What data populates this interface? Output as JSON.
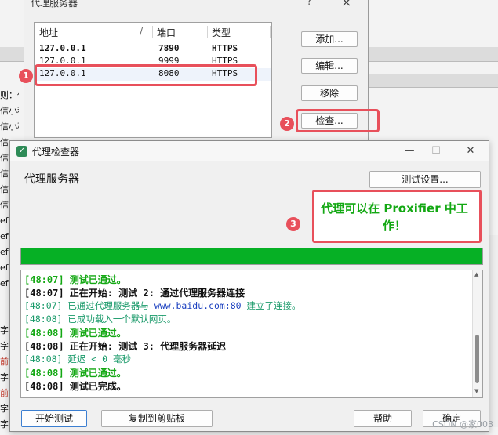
{
  "background": {
    "left_lines": [
      "则：代",
      "信小程",
      "信小程",
      "信",
      "信",
      "信",
      "信",
      "信",
      "efa",
      "efa",
      "efa",
      "efa",
      "efa",
      "",
      "",
      "字",
      "字",
      "前",
      "字",
      "前",
      "字",
      "字"
    ]
  },
  "proxy_servers_dialog": {
    "title": "代理服务器",
    "help_label": "?",
    "close_label": "×",
    "columns": {
      "address": "地址",
      "sort_arrow": "/",
      "port": "端口",
      "type": "类型"
    },
    "rows": [
      {
        "address": "127.0.0.1",
        "port": "7890",
        "type": "HTTPS",
        "bold": true
      },
      {
        "address": "127.0.0.1",
        "port": "9999",
        "type": "HTTPS",
        "bold": false
      },
      {
        "address": "127.0.0.1",
        "port": "8080",
        "type": "HTTPS",
        "bold": false
      }
    ],
    "buttons": {
      "add": "添加...",
      "edit": "编辑...",
      "remove": "移除",
      "check": "检查..."
    }
  },
  "annotations": {
    "badge1": "1",
    "badge2": "2",
    "badge3": "3"
  },
  "proxy_checker_dialog": {
    "title": "代理检查器",
    "minimize_label": "—",
    "maximize_label": "☐",
    "close_label": "✕",
    "proxy_server_label": "代理服务器",
    "test_settings_button": "测试设置...",
    "status_message": "代理可以在 Proxifier 中工作！",
    "progress_fraction": 1.0,
    "log": [
      {
        "text": "[48:07] 测试已通过。",
        "style": "green"
      },
      {
        "text": "[48:07] 正在开始: 测试 2: 通过代理服务器连接",
        "style": "bold"
      },
      {
        "prefix": "[48:07] 已通过代理服务器与 ",
        "link": "www.baidu.com:80",
        "suffix": " 建立了连接。",
        "style": "info"
      },
      {
        "text": "[48:08] 已成功载入一个默认网页。",
        "style": "info"
      },
      {
        "text": "[48:08] 测试已通过。",
        "style": "green"
      },
      {
        "text": "[48:08] 正在开始: 测试 3: 代理服务器延迟",
        "style": "bold"
      },
      {
        "text": "[48:08] 延迟 < 0 毫秒",
        "style": "info"
      },
      {
        "text": "[48:08] 测试已通过。",
        "style": "green"
      },
      {
        "text": "[48:08] 测试已完成。",
        "style": "bold"
      }
    ],
    "buttons": {
      "start": "开始测试",
      "copy": "复制到剪贴板",
      "help": "帮助",
      "ok": "确定"
    }
  },
  "watermark": "CSDN @家003"
}
